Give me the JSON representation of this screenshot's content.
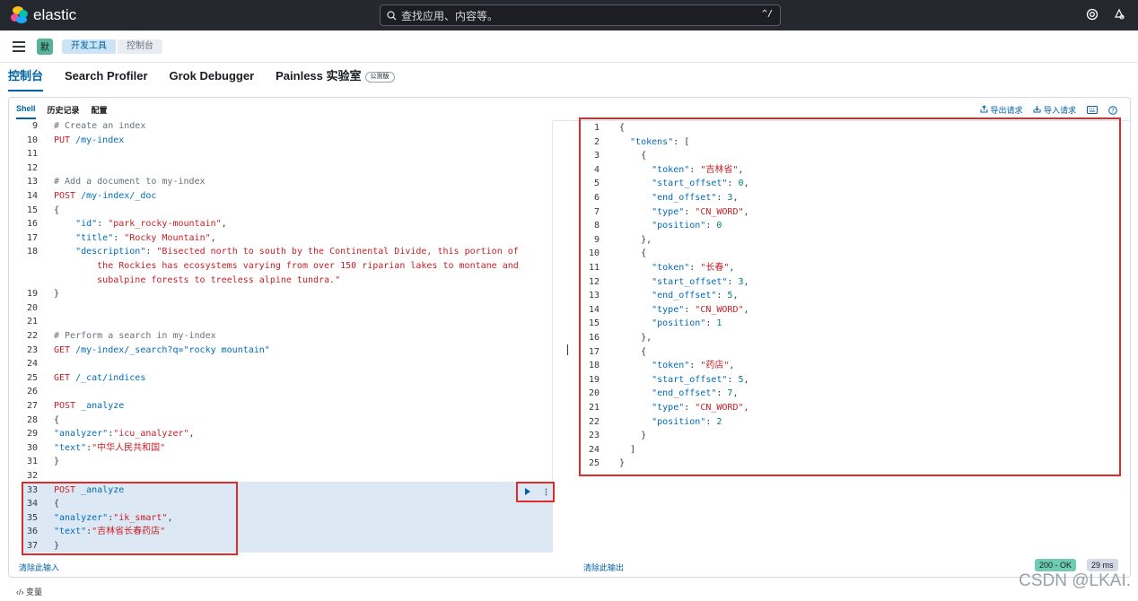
{
  "app": {
    "brand": "elastic"
  },
  "search": {
    "placeholder": "查找应用、内容等。",
    "shortcut": "^/"
  },
  "subbar": {
    "space_initial": "默",
    "breadcrumbs": [
      "开发工具",
      "控制台"
    ]
  },
  "tabs": [
    {
      "label": "控制台",
      "active": true
    },
    {
      "label": "Search Profiler",
      "active": false
    },
    {
      "label": "Grok Debugger",
      "active": false
    },
    {
      "label": "Painless 实验室",
      "active": false,
      "badge": "公测版"
    }
  ],
  "subtabs": [
    {
      "label": "Shell",
      "active": true
    },
    {
      "label": "历史记录",
      "active": false
    },
    {
      "label": "配置",
      "active": false
    }
  ],
  "actions": {
    "export": "导出请求",
    "import": "导入请求"
  },
  "editor": {
    "lines": [
      {
        "n": "9",
        "tokens": [
          [
            "c-comment",
            "# Create an index"
          ]
        ]
      },
      {
        "n": "10",
        "tokens": [
          [
            "c-method",
            "PUT"
          ],
          [
            "c-url",
            " /my-index"
          ]
        ]
      },
      {
        "n": "11",
        "tokens": []
      },
      {
        "n": "12",
        "tokens": []
      },
      {
        "n": "13",
        "tokens": [
          [
            "c-comment",
            "# Add a document to my-index"
          ]
        ]
      },
      {
        "n": "14",
        "tokens": [
          [
            "c-method",
            "POST"
          ],
          [
            "c-url",
            " /my-index/_doc"
          ]
        ]
      },
      {
        "n": "15",
        "tokens": [
          [
            "c-punct",
            "{"
          ]
        ]
      },
      {
        "n": "16",
        "tokens": [
          [
            "c-key",
            "    \"id\""
          ],
          [
            "c-punct",
            ": "
          ],
          [
            "c-str",
            "\"park_rocky-mountain\""
          ],
          [
            "c-punct",
            ","
          ]
        ]
      },
      {
        "n": "17",
        "tokens": [
          [
            "c-key",
            "    \"title\""
          ],
          [
            "c-punct",
            ": "
          ],
          [
            "c-str",
            "\"Rocky Mountain\""
          ],
          [
            "c-punct",
            ","
          ]
        ]
      },
      {
        "n": "18",
        "tokens": [
          [
            "c-key",
            "    \"description\""
          ],
          [
            "c-punct",
            ": "
          ],
          [
            "c-str",
            "\"Bisected north to south by the Continental Divide, this portion of"
          ]
        ]
      },
      {
        "n": "",
        "tokens": [
          [
            "c-str",
            "        the Rockies has ecosystems varying from over 150 riparian lakes to montane and"
          ]
        ]
      },
      {
        "n": "",
        "tokens": [
          [
            "c-str",
            "        subalpine forests to treeless alpine tundra.\""
          ]
        ]
      },
      {
        "n": "19",
        "tokens": [
          [
            "c-punct",
            "}"
          ]
        ]
      },
      {
        "n": "20",
        "tokens": []
      },
      {
        "n": "21",
        "tokens": []
      },
      {
        "n": "22",
        "tokens": [
          [
            "c-comment",
            "# Perform a search in my-index"
          ]
        ]
      },
      {
        "n": "23",
        "tokens": [
          [
            "c-method",
            "GET"
          ],
          [
            "c-url",
            " /my-index/_search?q=\"rocky mountain\""
          ]
        ]
      },
      {
        "n": "24",
        "tokens": []
      },
      {
        "n": "25",
        "tokens": [
          [
            "c-method",
            "GET"
          ],
          [
            "c-url",
            " /_cat/indices"
          ]
        ]
      },
      {
        "n": "26",
        "tokens": []
      },
      {
        "n": "27",
        "tokens": [
          [
            "c-method",
            "POST"
          ],
          [
            "c-url",
            " _analyze"
          ]
        ]
      },
      {
        "n": "28",
        "tokens": [
          [
            "c-punct",
            "{"
          ]
        ]
      },
      {
        "n": "29",
        "tokens": [
          [
            "c-key",
            "\"analyzer\""
          ],
          [
            "c-punct",
            ":"
          ],
          [
            "c-str",
            "\"icu_analyzer\""
          ],
          [
            "c-punct",
            ","
          ]
        ]
      },
      {
        "n": "30",
        "tokens": [
          [
            "c-key",
            "\"text\""
          ],
          [
            "c-punct",
            ":"
          ],
          [
            "c-str",
            "\"中华人民共和国\""
          ]
        ]
      },
      {
        "n": "31",
        "tokens": [
          [
            "c-punct",
            "}"
          ]
        ]
      },
      {
        "n": "32",
        "tokens": []
      },
      {
        "n": "33",
        "tokens": [
          [
            "c-method",
            "POST"
          ],
          [
            "c-url",
            " _analyze"
          ]
        ]
      },
      {
        "n": "34",
        "tokens": [
          [
            "c-punct",
            "{"
          ]
        ]
      },
      {
        "n": "35",
        "tokens": [
          [
            "c-key",
            "\"analyzer\""
          ],
          [
            "c-punct",
            ":"
          ],
          [
            "c-str",
            "\"ik_smart\""
          ],
          [
            "c-punct",
            ","
          ]
        ]
      },
      {
        "n": "36",
        "tokens": [
          [
            "c-key",
            "\"text\""
          ],
          [
            "c-punct",
            ":"
          ],
          [
            "c-str",
            "\"吉林省长春药店\""
          ]
        ]
      },
      {
        "n": "37",
        "tokens": [
          [
            "c-punct",
            "}"
          ]
        ]
      }
    ]
  },
  "output": {
    "lines": [
      {
        "n": "1",
        "tokens": [
          [
            "c-punct",
            "{"
          ]
        ]
      },
      {
        "n": "2",
        "tokens": [
          [
            "c-key",
            "  \"tokens\""
          ],
          [
            "c-punct",
            ": ["
          ]
        ]
      },
      {
        "n": "3",
        "tokens": [
          [
            "c-punct",
            "    {"
          ]
        ]
      },
      {
        "n": "4",
        "tokens": [
          [
            "c-key",
            "      \"token\""
          ],
          [
            "c-punct",
            ": "
          ],
          [
            "c-str",
            "\"吉林省\""
          ],
          [
            "c-punct",
            ","
          ]
        ]
      },
      {
        "n": "5",
        "tokens": [
          [
            "c-key",
            "      \"start_offset\""
          ],
          [
            "c-punct",
            ": "
          ],
          [
            "c-num",
            "0"
          ],
          [
            "c-punct",
            ","
          ]
        ]
      },
      {
        "n": "6",
        "tokens": [
          [
            "c-key",
            "      \"end_offset\""
          ],
          [
            "c-punct",
            ": "
          ],
          [
            "c-num",
            "3"
          ],
          [
            "c-punct",
            ","
          ]
        ]
      },
      {
        "n": "7",
        "tokens": [
          [
            "c-key",
            "      \"type\""
          ],
          [
            "c-punct",
            ": "
          ],
          [
            "c-str",
            "\"CN_WORD\""
          ],
          [
            "c-punct",
            ","
          ]
        ]
      },
      {
        "n": "8",
        "tokens": [
          [
            "c-key",
            "      \"position\""
          ],
          [
            "c-punct",
            ": "
          ],
          [
            "c-num",
            "0"
          ]
        ]
      },
      {
        "n": "9",
        "tokens": [
          [
            "c-punct",
            "    },"
          ]
        ]
      },
      {
        "n": "10",
        "tokens": [
          [
            "c-punct",
            "    {"
          ]
        ]
      },
      {
        "n": "11",
        "tokens": [
          [
            "c-key",
            "      \"token\""
          ],
          [
            "c-punct",
            ": "
          ],
          [
            "c-str",
            "\"长春\""
          ],
          [
            "c-punct",
            ","
          ]
        ]
      },
      {
        "n": "12",
        "tokens": [
          [
            "c-key",
            "      \"start_offset\""
          ],
          [
            "c-punct",
            ": "
          ],
          [
            "c-num",
            "3"
          ],
          [
            "c-punct",
            ","
          ]
        ]
      },
      {
        "n": "13",
        "tokens": [
          [
            "c-key",
            "      \"end_offset\""
          ],
          [
            "c-punct",
            ": "
          ],
          [
            "c-num",
            "5"
          ],
          [
            "c-punct",
            ","
          ]
        ]
      },
      {
        "n": "14",
        "tokens": [
          [
            "c-key",
            "      \"type\""
          ],
          [
            "c-punct",
            ": "
          ],
          [
            "c-str",
            "\"CN_WORD\""
          ],
          [
            "c-punct",
            ","
          ]
        ]
      },
      {
        "n": "15",
        "tokens": [
          [
            "c-key",
            "      \"position\""
          ],
          [
            "c-punct",
            ": "
          ],
          [
            "c-num",
            "1"
          ]
        ]
      },
      {
        "n": "16",
        "tokens": [
          [
            "c-punct",
            "    },"
          ]
        ]
      },
      {
        "n": "17",
        "tokens": [
          [
            "c-punct",
            "    {"
          ]
        ]
      },
      {
        "n": "18",
        "tokens": [
          [
            "c-key",
            "      \"token\""
          ],
          [
            "c-punct",
            ": "
          ],
          [
            "c-str",
            "\"药店\""
          ],
          [
            "c-punct",
            ","
          ]
        ]
      },
      {
        "n": "19",
        "tokens": [
          [
            "c-key",
            "      \"start_offset\""
          ],
          [
            "c-punct",
            ": "
          ],
          [
            "c-num",
            "5"
          ],
          [
            "c-punct",
            ","
          ]
        ]
      },
      {
        "n": "20",
        "tokens": [
          [
            "c-key",
            "      \"end_offset\""
          ],
          [
            "c-punct",
            ": "
          ],
          [
            "c-num",
            "7"
          ],
          [
            "c-punct",
            ","
          ]
        ]
      },
      {
        "n": "21",
        "tokens": [
          [
            "c-key",
            "      \"type\""
          ],
          [
            "c-punct",
            ": "
          ],
          [
            "c-str",
            "\"CN_WORD\""
          ],
          [
            "c-punct",
            ","
          ]
        ]
      },
      {
        "n": "22",
        "tokens": [
          [
            "c-key",
            "      \"position\""
          ],
          [
            "c-punct",
            ": "
          ],
          [
            "c-num",
            "2"
          ]
        ]
      },
      {
        "n": "23",
        "tokens": [
          [
            "c-punct",
            "    }"
          ]
        ]
      },
      {
        "n": "24",
        "tokens": [
          [
            "c-punct",
            "  ]"
          ]
        ]
      },
      {
        "n": "25",
        "tokens": [
          [
            "c-punct",
            "}"
          ]
        ]
      }
    ]
  },
  "footer": {
    "clear_input": "清除此输入",
    "clear_output": "清除此输出",
    "status": "200 - OK",
    "duration": "29 ms",
    "variables": "变量"
  },
  "watermark": "CSDN @LKAI."
}
